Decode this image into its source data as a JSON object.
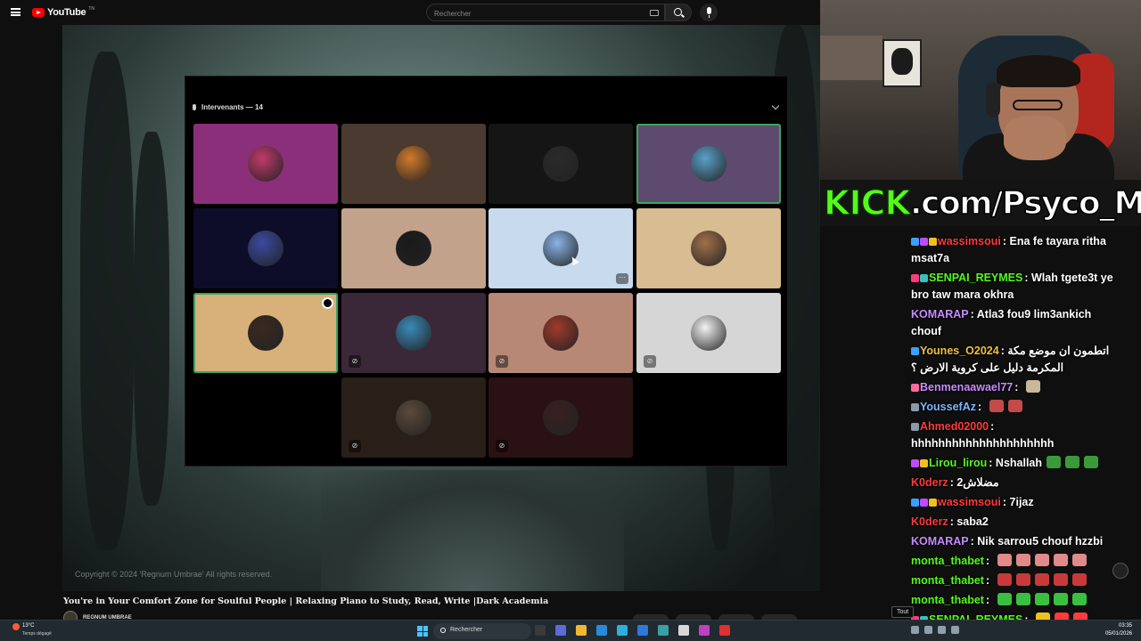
{
  "youtube": {
    "logo_text": "YouTube",
    "logo_tm": "TN",
    "search_placeholder": "Rechercher",
    "copyright": "Copyright © 2024 'Regnum Umbrae' All rights reserved.",
    "video_title": "You're in Your Comfort Zone for Soulful People | Relaxing Piano to Study, Read, Write |Dark Academia",
    "channel_name": "REGNUM UMBRAE"
  },
  "discord": {
    "header_title": "Intervenants — 14",
    "tiles": [
      {
        "bg": "#8c2f7a",
        "avatar": "#c03a6a"
      },
      {
        "bg": "#4a3a30",
        "avatar": "#d27a2a"
      },
      {
        "bg": "#151515",
        "avatar": "#2a2a2a"
      },
      {
        "bg": "#5e4a6e",
        "avatar": "#5aa0c8",
        "active": true
      },
      {
        "bg": "#0d0d2a",
        "avatar": "#3a4aa0"
      },
      {
        "bg": "#c2a28a",
        "avatar": "#1a1a1a"
      },
      {
        "bg": "#c8dbee",
        "avatar": "#8ab4e6",
        "more": true
      },
      {
        "bg": "#d8bc92",
        "avatar": "#a0704a"
      },
      {
        "bg": "#d8b07a",
        "avatar": "#3a2a20",
        "active": true,
        "stream": true
      },
      {
        "bg": "#3a2838",
        "avatar": "#3a8ab8",
        "muted": true
      },
      {
        "bg": "#b88876",
        "avatar": "#a03a2a",
        "muted": true
      },
      {
        "bg": "#d6d6d6",
        "avatar": "#f2f2f2",
        "muted": true
      },
      {
        "bg": "#2a1e18",
        "avatar": "#5a4a3a",
        "muted": true
      },
      {
        "bg": "#2a1214",
        "avatar": "#3a2020",
        "muted": true
      }
    ]
  },
  "kick_banner": {
    "brand": "KICK",
    "url": ".com/Psyco_M"
  },
  "chat": [
    {
      "user": "wassimsoui",
      "color": "#ff3b3b",
      "badges": [
        "#3aa0ff",
        "#c04aff",
        "#f0c020"
      ],
      "text": "Ena fe tayara ritha msat7a"
    },
    {
      "user": "SENPAI_REYMES",
      "color": "#53fc18",
      "badges": [
        "#ff3b7a",
        "#3ac0c0"
      ],
      "text": "Wlah tgete3t ye bro taw mara okhra"
    },
    {
      "user": "KOMARAP",
      "color": "#c78cff",
      "badges": [],
      "text": "Atla3 fou9 lim3ankich chouf"
    },
    {
      "user": "Younes_O2024",
      "color": "#f0c040",
      "badges": [
        "#3aa0ff"
      ],
      "text": "اتطمون ان موضع مكة المكرمة دليل على كروية الارض ؟"
    },
    {
      "user": "Benmenaawael77",
      "color": "#c78cff",
      "badges": [
        "#ff6a9a"
      ],
      "text": "",
      "emotes": [
        "#c9b89a"
      ]
    },
    {
      "user": "YoussefAz",
      "color": "#7ab8ff",
      "badges": [
        "#8a9aaa"
      ],
      "text": "",
      "emotes": [
        "#c44a4a",
        "#c44a4a"
      ]
    },
    {
      "user": "Ahmed02000",
      "color": "#ff3b3b",
      "badges": [
        "#8a9aaa"
      ],
      "text": "hhhhhhhhhhhhhhhhhhhhh"
    },
    {
      "user": "Lirou_lirou",
      "color": "#53fc18",
      "badges": [
        "#c04aff",
        "#f0c020"
      ],
      "text": "Nshallah",
      "emotes": [
        "#3a9a3a",
        "#3a9a3a",
        "#3a9a3a"
      ]
    },
    {
      "user": "K0derz",
      "color": "#ff3b3b",
      "badges": [],
      "text": "مضلاش2"
    },
    {
      "user": "wassimsoui",
      "color": "#ff3b3b",
      "badges": [
        "#3aa0ff",
        "#c04aff",
        "#f0c020"
      ],
      "text": "7ijaz"
    },
    {
      "user": "K0derz",
      "color": "#ff3b3b",
      "badges": [],
      "text": "saba2"
    },
    {
      "user": "KOMARAP",
      "color": "#c78cff",
      "badges": [],
      "text": "Nik sarrou5 chouf hzzbi"
    },
    {
      "user": "monta_thabet",
      "color": "#53fc18",
      "badges": [],
      "text": "",
      "emotes": [
        "#e08a8a",
        "#e08a8a",
        "#e08a8a",
        "#e08a8a",
        "#e08a8a"
      ]
    },
    {
      "user": "monta_thabet",
      "color": "#53fc18",
      "badges": [],
      "text": "",
      "emotes": [
        "#c83a3a",
        "#c83a3a",
        "#c83a3a",
        "#c83a3a",
        "#c83a3a"
      ]
    },
    {
      "user": "monta_thabet",
      "color": "#53fc18",
      "badges": [],
      "text": "",
      "emotes": [
        "#3ac040",
        "#3ac040",
        "#3ac040",
        "#3ac040",
        "#3ac040"
      ]
    },
    {
      "user": "SENPAI_REYMES",
      "color": "#53fc18",
      "badges": [
        "#ff3b7a",
        "#3ac0c0"
      ],
      "text": "",
      "emotes": [
        "#f0c020",
        "#ff3b3b",
        "#ff3b3b"
      ]
    }
  ],
  "tooltip": "Tout",
  "taskbar": {
    "weather_temp": "13°C",
    "weather_desc": "Temps dégagé",
    "search_label": "Rechercher",
    "time": "03:35",
    "date": "05/01/2026",
    "apps": [
      "#3a3a3a",
      "#5b6bd8",
      "#f0b830",
      "#2a8ad8",
      "#2ab0e0",
      "#2f7ad8",
      "#3aa0a0",
      "#d8d8d8",
      "#c040c0",
      "#e03030"
    ]
  }
}
